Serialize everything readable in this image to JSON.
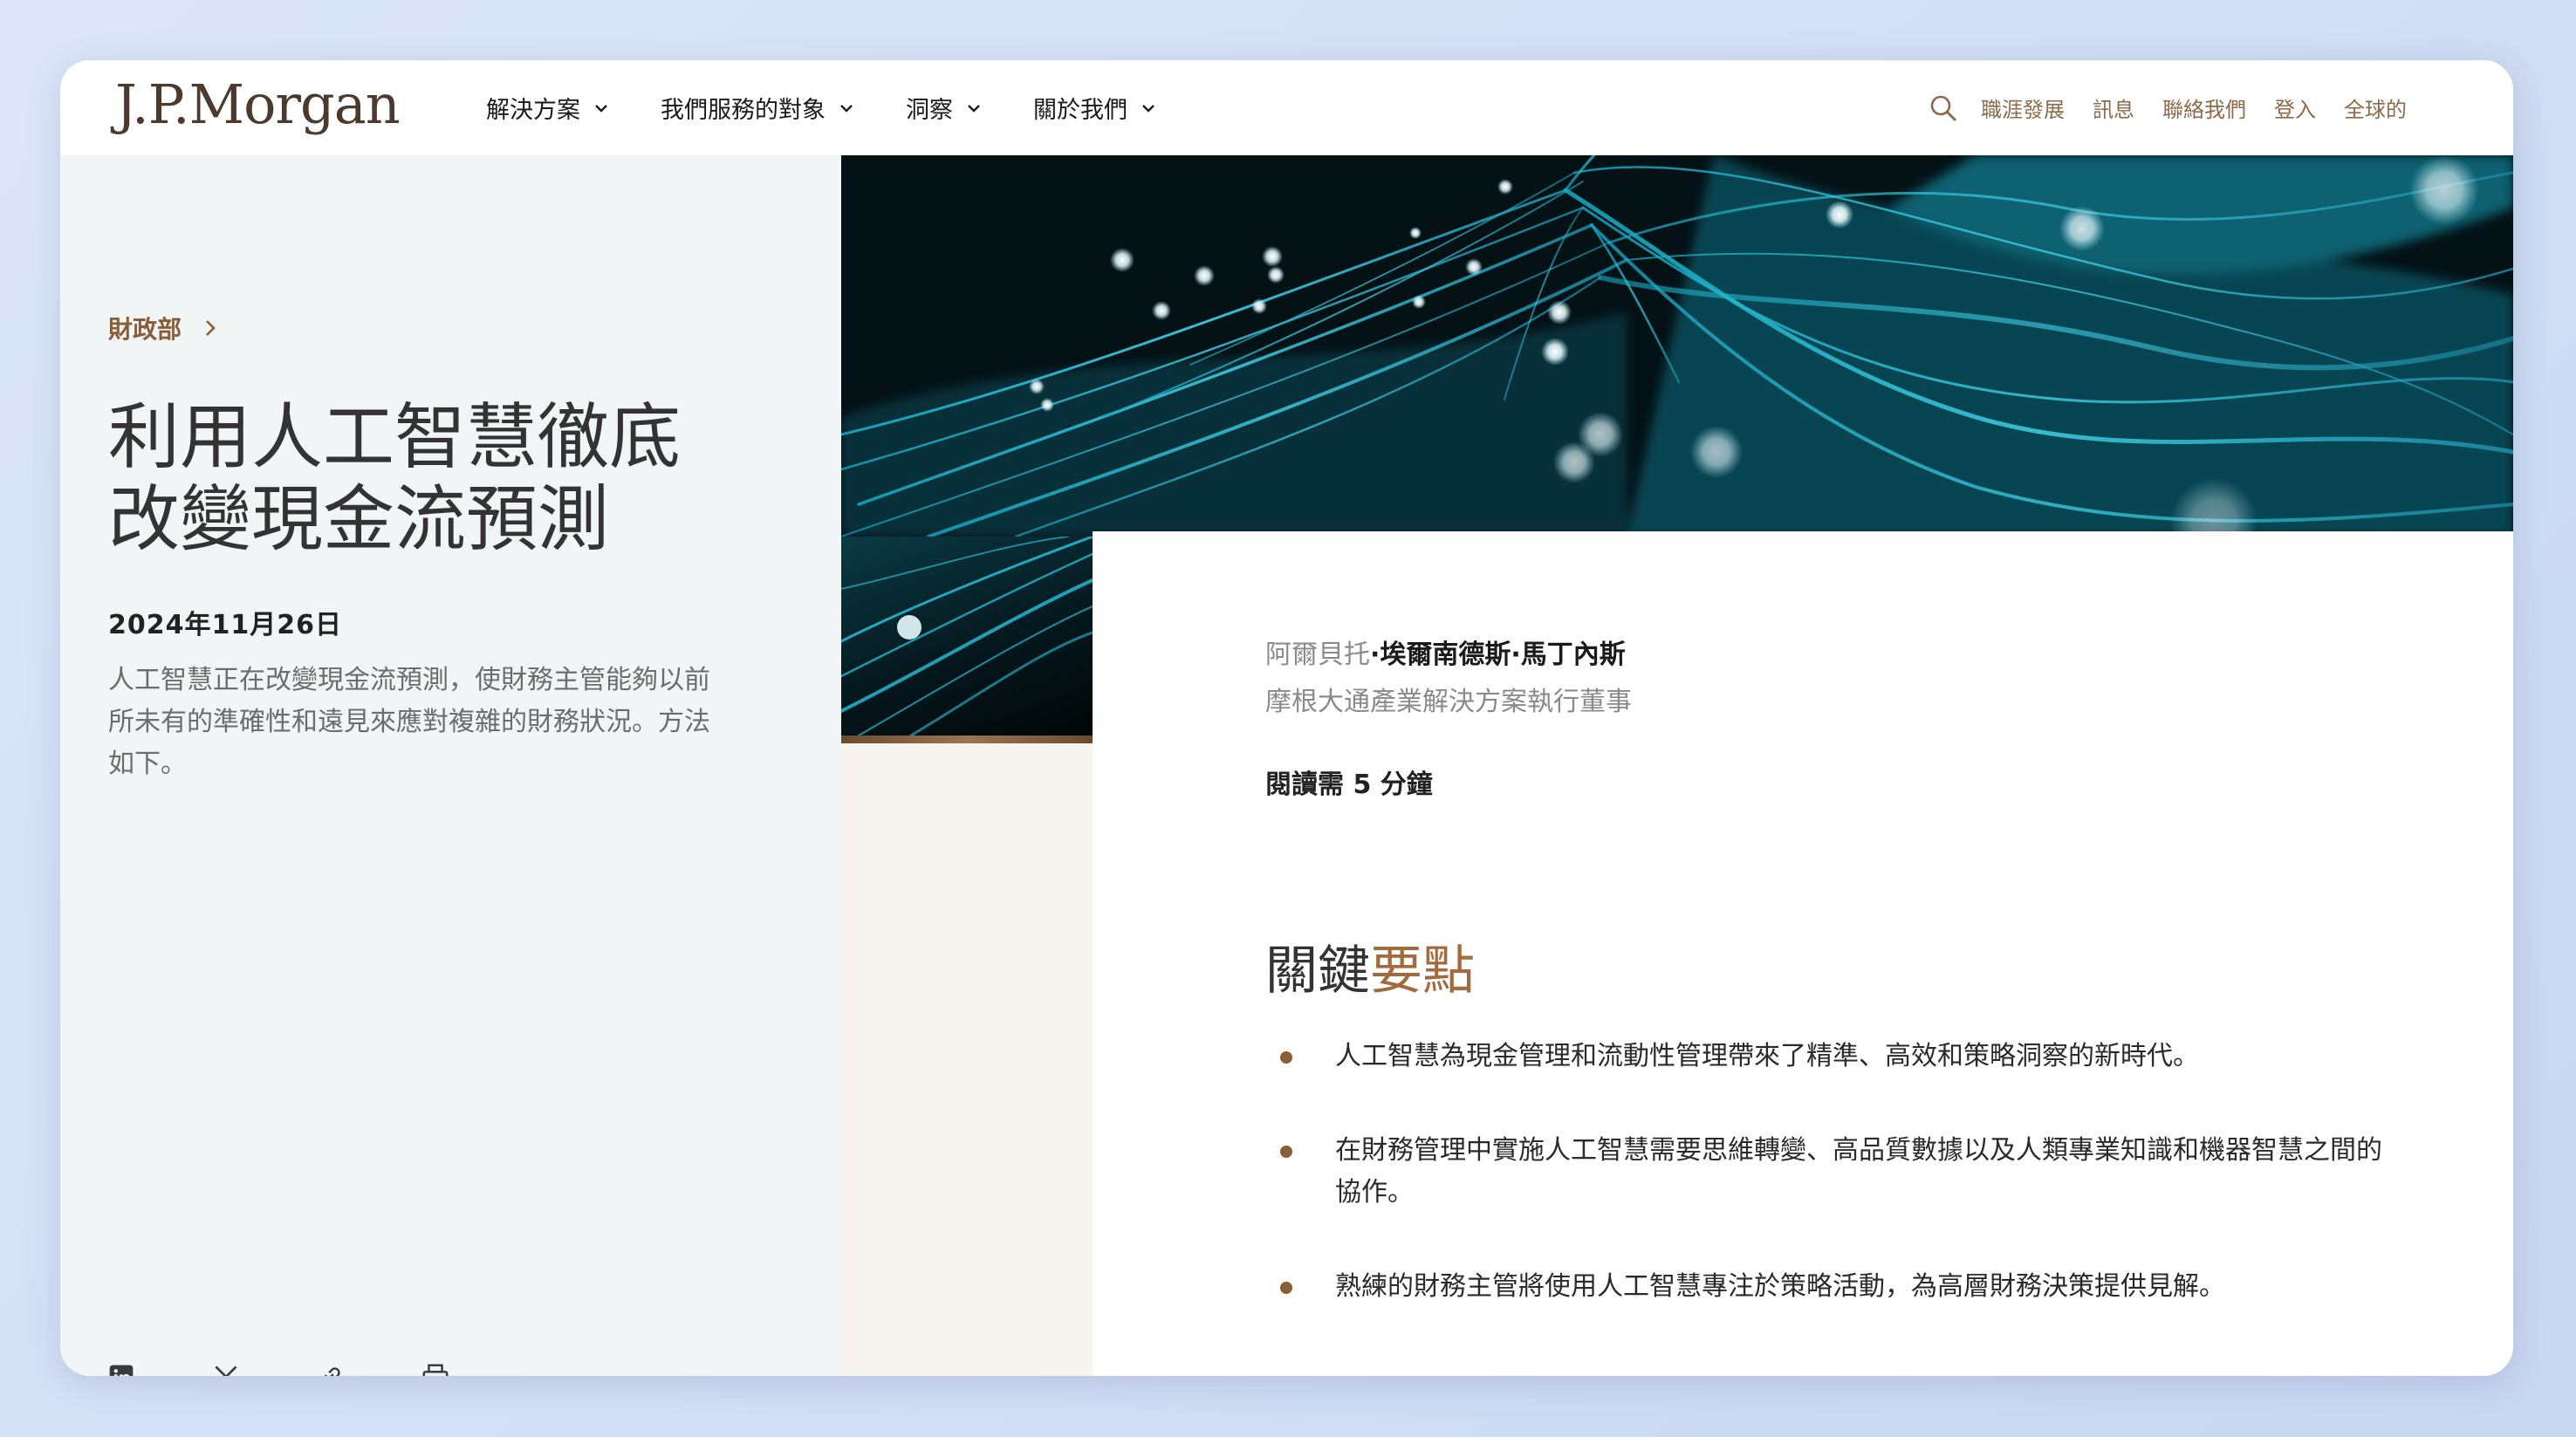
{
  "header": {
    "logo": "J.P.Morgan",
    "nav": [
      {
        "label": "解決方案"
      },
      {
        "label": "我們服務的對象"
      },
      {
        "label": "洞察"
      },
      {
        "label": "關於我們"
      }
    ],
    "utility": [
      {
        "label": "職涯發展"
      },
      {
        "label": "訊息"
      },
      {
        "label": "聯絡我們"
      },
      {
        "label": "登入"
      },
      {
        "label": "全球的"
      }
    ]
  },
  "article": {
    "breadcrumb": "財政部",
    "title_line1": "利用人工智慧徹底",
    "title_line2": "改變現金流預測",
    "date": "2024年11月26日",
    "summary": "人工智慧正在改變現金流預測，使財務主管能夠以前所未有的準確性和遠見來應對複雜的財務狀況。方法如下。",
    "author_prefix": "阿爾貝托",
    "author_name": "·埃爾南德斯·馬丁內斯",
    "author_role": "摩根大通產業解決方案執行董事",
    "read_time": "閱讀需 5 分鐘",
    "key_title_part1": "關鍵",
    "key_title_part2": "要點",
    "key_points": [
      "人工智慧為現金管理和流動性管理帶來了精準、高效和策略洞察的新時代。",
      "在財務管理中實施人工智慧需要思維轉變、高品質數據以及人類專業知識和機器智慧之間的協作。",
      "熟練的財務主管將使用人工智慧專注於策略活動，為高層財務決策提供見解。"
    ]
  },
  "share": [
    "linkedin-icon",
    "x-icon",
    "link-icon",
    "print-icon"
  ],
  "colors": {
    "accent": "#8c6a48",
    "panel_bg": "#f2f5f6",
    "bullet": "#8b5e36"
  }
}
